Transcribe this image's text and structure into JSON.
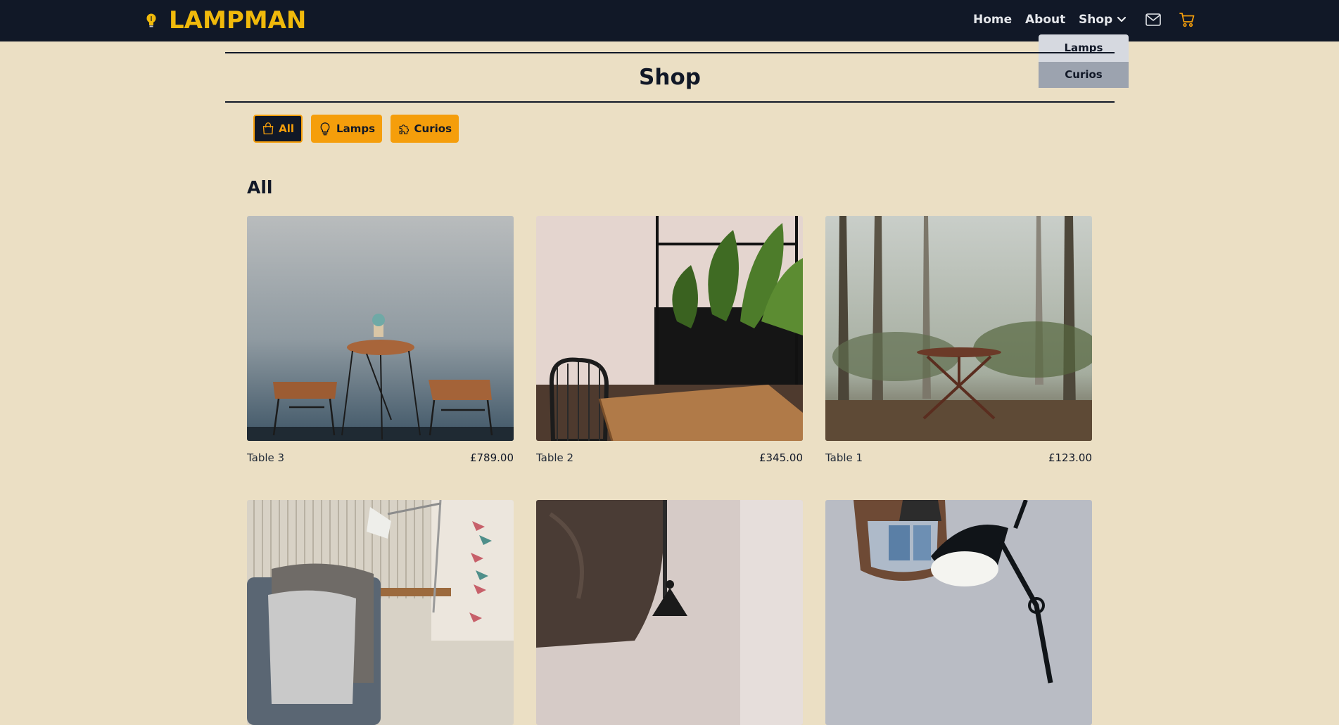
{
  "brand": {
    "name": "LAMPMAN",
    "logo_icon": "lightbulb-icon"
  },
  "nav": {
    "links": [
      "Home",
      "About",
      "Shop"
    ],
    "shop_chevron_icon": "chevron-down-icon",
    "mail_icon": "mail-icon",
    "cart_icon": "cart-icon"
  },
  "dropdown": {
    "items": [
      "Lamps",
      "Curios"
    ],
    "hovered": "Curios"
  },
  "page": {
    "title": "Shop"
  },
  "filters": [
    {
      "label": "All",
      "icon": "shopping-bag-icon",
      "active": true
    },
    {
      "label": "Lamps",
      "icon": "lightbulb-icon",
      "active": false
    },
    {
      "label": "Curios",
      "icon": "puzzle-icon",
      "active": false
    }
  ],
  "section": {
    "title": "All"
  },
  "products": [
    {
      "name": "Table 3",
      "price": "£789.00"
    },
    {
      "name": "Table 2",
      "price": "£345.00"
    },
    {
      "name": "Table 1",
      "price": "£123.00"
    },
    {
      "name": "",
      "price": ""
    },
    {
      "name": "",
      "price": ""
    },
    {
      "name": "",
      "price": ""
    }
  ],
  "colors": {
    "navbar": "#111827",
    "brand": "#f0b90b",
    "background": "#ebdfc4",
    "accent": "#f59e0b"
  }
}
